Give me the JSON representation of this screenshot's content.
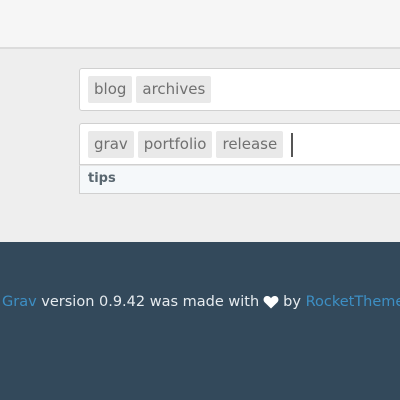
{
  "tag_field_1": {
    "tags": [
      "blog",
      "archives"
    ]
  },
  "tag_field_2": {
    "tags": [
      "grav",
      "portfolio",
      "release"
    ]
  },
  "suggestions": [
    "tips"
  ],
  "footer": {
    "product_link": "Grav",
    "version_text": "version 0.9.42 was made with",
    "heart_icon": "heart-icon",
    "by_text": "by",
    "author_link": "RocketTheme",
    "end_punct": ".",
    "colors": {
      "background": "#33495b",
      "link": "#3d8fc4",
      "text": "#e6ebef"
    }
  }
}
